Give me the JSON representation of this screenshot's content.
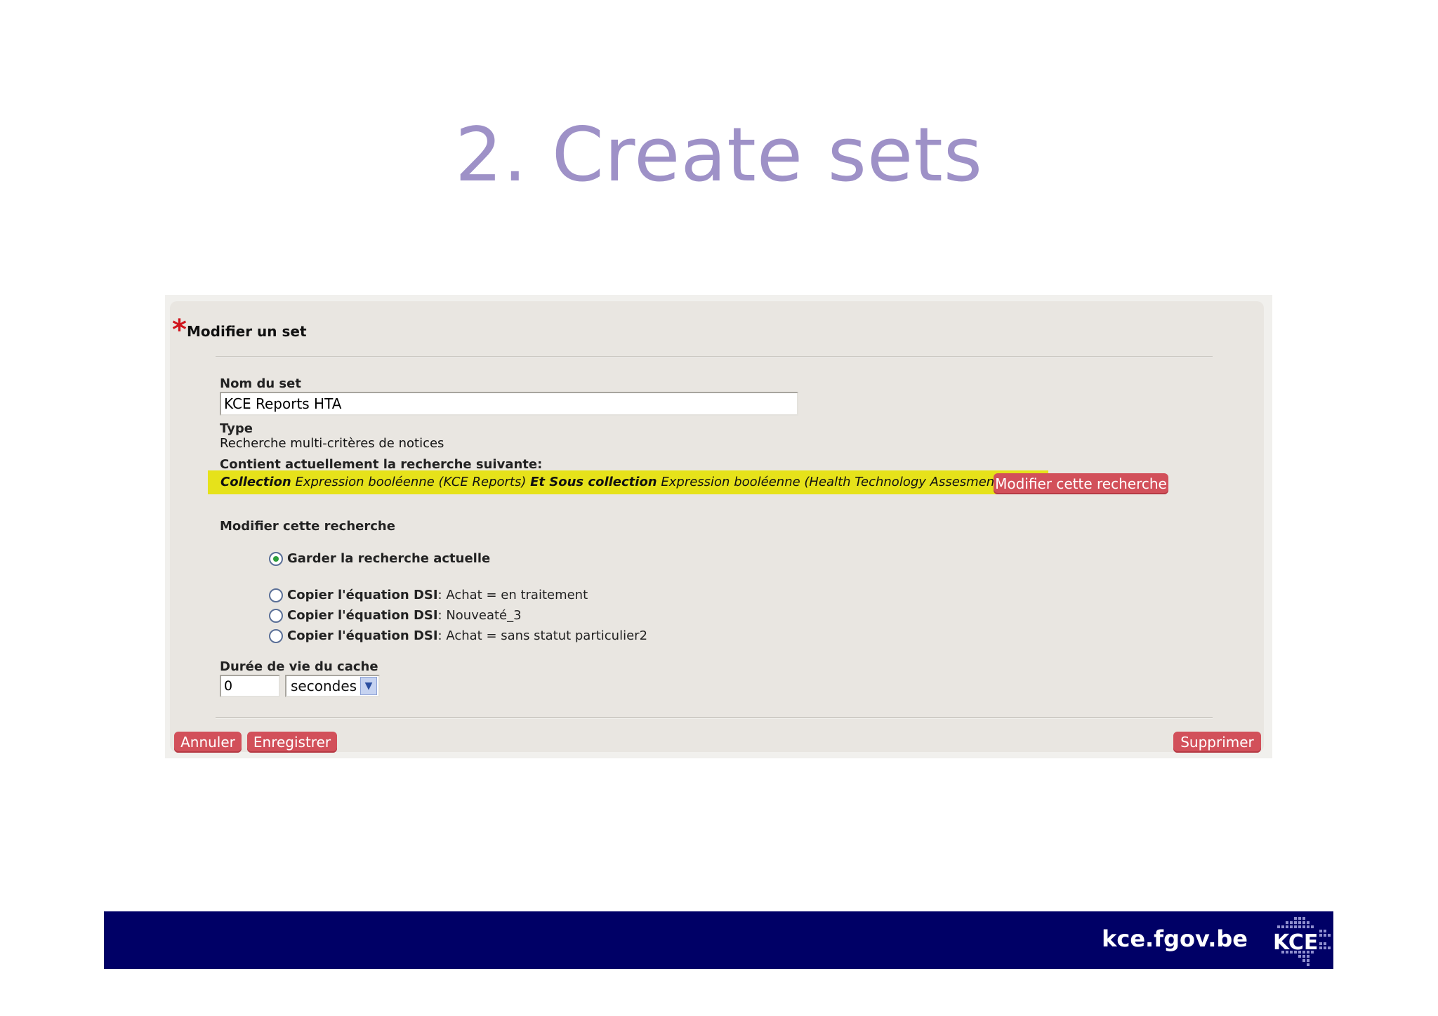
{
  "slide": {
    "title": "2. Create sets"
  },
  "form": {
    "required_marker": "*",
    "heading": "Modifier un set",
    "set_name_label": "Nom du set",
    "set_name_value": "KCE Reports HTA",
    "type_label": "Type",
    "type_value": "Recherche multi-critères de notices",
    "current_search_label": "Contient actuellement la recherche suivante:",
    "current_search": {
      "part1_bold": "Collection",
      "part2": " Expression booléenne (KCE Reports) ",
      "part3_bold": "Et Sous collection",
      "part4": " Expression booléenne (Health Technology Assesment (HTA))"
    },
    "modify_search_button": "Modifier cette recherche",
    "modify_search_label": "Modifier cette recherche",
    "options": [
      {
        "label_bold": "Garder la recherche actuelle",
        "label_rest": "",
        "selected": true
      },
      {
        "label_bold": "Copier l'équation DSI",
        "label_rest": ": Achat = en traitement",
        "selected": false
      },
      {
        "label_bold": "Copier l'équation DSI",
        "label_rest": ": Nouveaté_3",
        "selected": false
      },
      {
        "label_bold": "Copier l'équation DSI",
        "label_rest": ": Achat = sans statut particulier2",
        "selected": false
      }
    ],
    "cache_label": "Durée de vie du cache",
    "cache_value": "0",
    "cache_unit": "secondes",
    "cancel_button": "Annuler",
    "save_button": "Enregistrer",
    "delete_button": "Supprimer"
  },
  "footer": {
    "url": "kce.fgov.be",
    "logo_text": "KCE"
  },
  "colors": {
    "title": "#9e91c7",
    "highlight": "#e6e21a",
    "button": "#d2505a",
    "footer_bg": "#000066"
  }
}
